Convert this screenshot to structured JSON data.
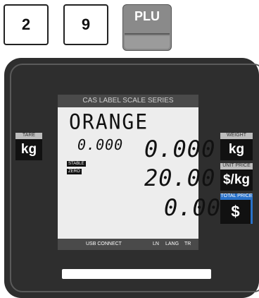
{
  "keypad": {
    "key_1": "2",
    "key_2": "9",
    "plu_label": "PLU"
  },
  "lcd": {
    "header": "CAS LABEL SCALE SERIES",
    "item_name": "ORANGE",
    "tare_value": "0.000",
    "weight_value": "0.000",
    "unit_price_value": "20.00",
    "total_price_value": "0.00",
    "stable_badge": "STABLE",
    "zero_badge": "ZERO",
    "footer": {
      "usb": "USB CONNECT",
      "ln": "LN",
      "lang": "LANG",
      "tr": "TR"
    }
  },
  "side_labels": {
    "tare_tab": "TARE",
    "tare_unit": "kg",
    "weight_tab": "WEIGHT",
    "weight_unit": "kg",
    "unit_price_tab": "UNIT PRICE",
    "unit_price_unit": "$/kg",
    "total_price_tab": "TOTAL PRICE",
    "total_price_unit": "$"
  },
  "colors": {
    "panel": "#2e2e2e",
    "lcd_background": "#ededed",
    "accent_total": "#2a72c9"
  }
}
